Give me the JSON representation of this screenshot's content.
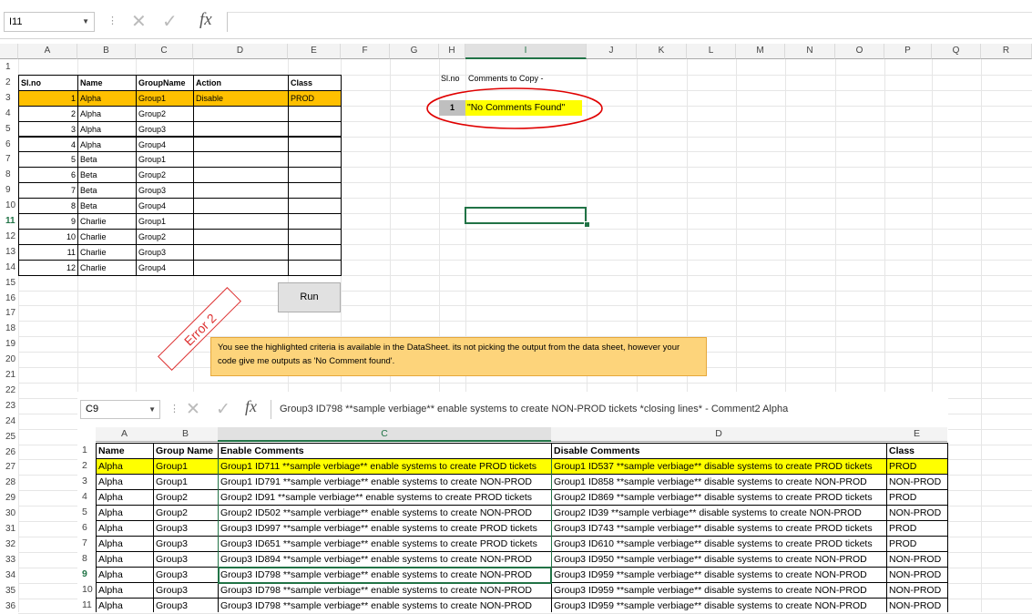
{
  "formula_bar": {
    "name_box": "I11",
    "fx": "fx",
    "formula": ""
  },
  "columns": [
    "A",
    "B",
    "C",
    "D",
    "E",
    "F",
    "G",
    "H",
    "I",
    "J",
    "K",
    "L",
    "M",
    "N",
    "O",
    "P",
    "Q",
    "R"
  ],
  "rows": [
    "1",
    "2",
    "3",
    "4",
    "5",
    "6",
    "7",
    "8",
    "9",
    "10",
    "11",
    "12",
    "13",
    "14",
    "15",
    "16",
    "17",
    "18",
    "19",
    "20",
    "21",
    "22",
    "23",
    "24",
    "25",
    "26",
    "27",
    "28",
    "29",
    "30",
    "31",
    "32",
    "33",
    "34",
    "35",
    "36"
  ],
  "table": {
    "headers": [
      "Sl.no",
      "Name",
      "GroupName",
      "Action",
      "Class"
    ],
    "rows": [
      [
        "1",
        "Alpha",
        "Group1",
        "Disable",
        "PROD"
      ],
      [
        "2",
        "Alpha",
        "Group2",
        "",
        ""
      ],
      [
        "3",
        "Alpha",
        "Group3",
        "",
        ""
      ],
      [
        "4",
        "Alpha",
        "Group4",
        "",
        ""
      ],
      [
        "5",
        "Beta",
        "Group1",
        "",
        ""
      ],
      [
        "6",
        "Beta",
        "Group2",
        "",
        ""
      ],
      [
        "7",
        "Beta",
        "Group3",
        "",
        ""
      ],
      [
        "8",
        "Beta",
        "Group4",
        "",
        ""
      ],
      [
        "9",
        "Charlie",
        "Group1",
        "",
        ""
      ],
      [
        "10",
        "Charlie",
        "Group2",
        "",
        ""
      ],
      [
        "11",
        "Charlie",
        "Group3",
        "",
        ""
      ],
      [
        "12",
        "Charlie",
        "Group4",
        "",
        ""
      ]
    ]
  },
  "result": {
    "h_header": "Sl.no",
    "i_header": "Comments to Copy -",
    "num": "1",
    "value": "\"No Comments Found\""
  },
  "run_button": "Run",
  "error_label": "Error 2",
  "note": "You see the highlighted criteria is available in the DataSheet. its not picking the output from the data sheet, however your code give me outputs as 'No Comment found'.",
  "embedded": {
    "name_box": "C9",
    "fx": "fx",
    "formula": "Group3 ID798 **sample verbiage** enable systems to create NON-PROD tickets *closing lines* - Comment2 Alpha",
    "columns": [
      "A",
      "B",
      "C",
      "D",
      "E"
    ],
    "row_numbers": [
      "1",
      "2",
      "3",
      "4",
      "5",
      "6",
      "7",
      "8",
      "9",
      "10",
      "11"
    ],
    "headers": [
      "Name",
      "Group Name",
      "Enable Comments",
      "Disable Comments",
      "Class"
    ],
    "rows": [
      [
        "Alpha",
        "Group1",
        "Group1 ID711 **sample verbiage** enable systems to create PROD tickets",
        "Group1 ID537 **sample verbiage** disable systems to create PROD tickets",
        "PROD"
      ],
      [
        "Alpha",
        "Group1",
        "Group1 ID791 **sample verbiage** enable systems to create NON-PROD",
        "Group1 ID858 **sample verbiage** disable systems to create NON-PROD",
        "NON-PROD"
      ],
      [
        "Alpha",
        "Group2",
        "Group2 ID91 **sample verbiage** enable systems to create PROD tickets",
        "Group2 ID869 **sample verbiage** disable systems to create PROD tickets",
        "PROD"
      ],
      [
        "Alpha",
        "Group2",
        "Group2 ID502 **sample verbiage** enable systems to create NON-PROD",
        "Group2 ID39 **sample verbiage** disable systems to create NON-PROD",
        "NON-PROD"
      ],
      [
        "Alpha",
        "Group3",
        "Group3 ID997 **sample verbiage** enable systems to create PROD tickets",
        "Group3 ID743 **sample verbiage** disable systems to create PROD tickets",
        "PROD"
      ],
      [
        "Alpha",
        "Group3",
        "Group3 ID651 **sample verbiage** enable systems to create PROD tickets",
        "Group3 ID610 **sample verbiage** disable systems to create PROD tickets",
        "PROD"
      ],
      [
        "Alpha",
        "Group3",
        "Group3 ID894 **sample verbiage** enable systems to create NON-PROD",
        "Group3 ID950 **sample verbiage** disable systems to create NON-PROD",
        "NON-PROD"
      ],
      [
        "Alpha",
        "Group3",
        "Group3 ID798 **sample verbiage** enable systems to create NON-PROD",
        "Group3 ID959 **sample verbiage** disable systems to create NON-PROD",
        "NON-PROD"
      ],
      [
        "Alpha",
        "Group3",
        "Group3 ID798 **sample verbiage** enable systems to create NON-PROD",
        "Group3 ID959 **sample verbiage** disable systems to create NON-PROD",
        "NON-PROD"
      ],
      [
        "Alpha",
        "Group3",
        "Group3 ID798 **sample verbiage** enable systems to create NON-PROD",
        "Group3 ID959 **sample verbiage** disable systems to create NON-PROD",
        "NON-PROD"
      ]
    ]
  },
  "colors": {
    "highlight_orange": "#ffc000",
    "highlight_yellow": "#ffff00",
    "selection_green": "#217346",
    "ellipse_red": "#e00000",
    "note_fill": "#fdd47b"
  }
}
